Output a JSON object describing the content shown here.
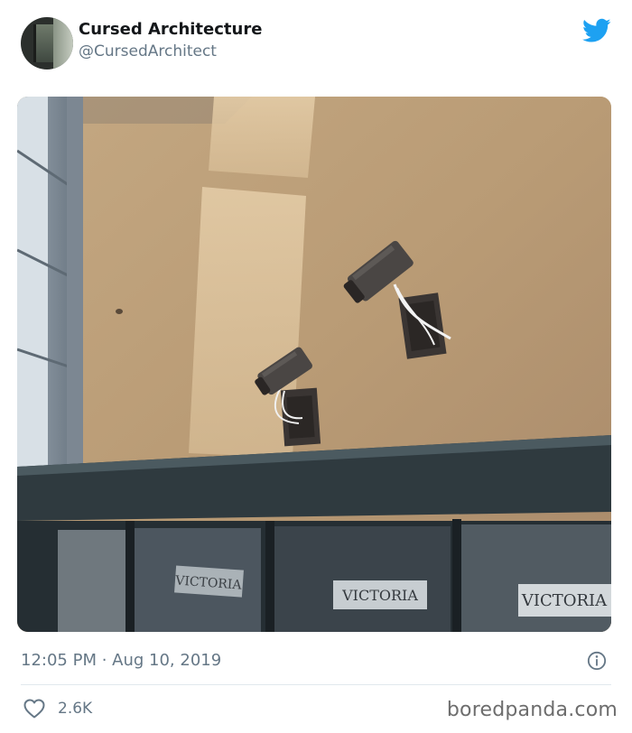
{
  "tweet": {
    "display_name": "Cursed Architecture",
    "handle": "@CursedArchitect",
    "timestamp": "12:05 PM · Aug 10, 2019",
    "likes": "2.6K"
  },
  "photo": {
    "signs": [
      "VICTORIA",
      "VICTORIA",
      "VICTORIA"
    ]
  },
  "watermark": "boredpanda.com",
  "icons": {
    "brand": "twitter-bird-icon",
    "info": "info-icon",
    "like": "heart-icon"
  },
  "colors": {
    "twitter_blue": "#1da1f2",
    "secondary_text": "#657786",
    "divider": "#e1e8ed"
  }
}
